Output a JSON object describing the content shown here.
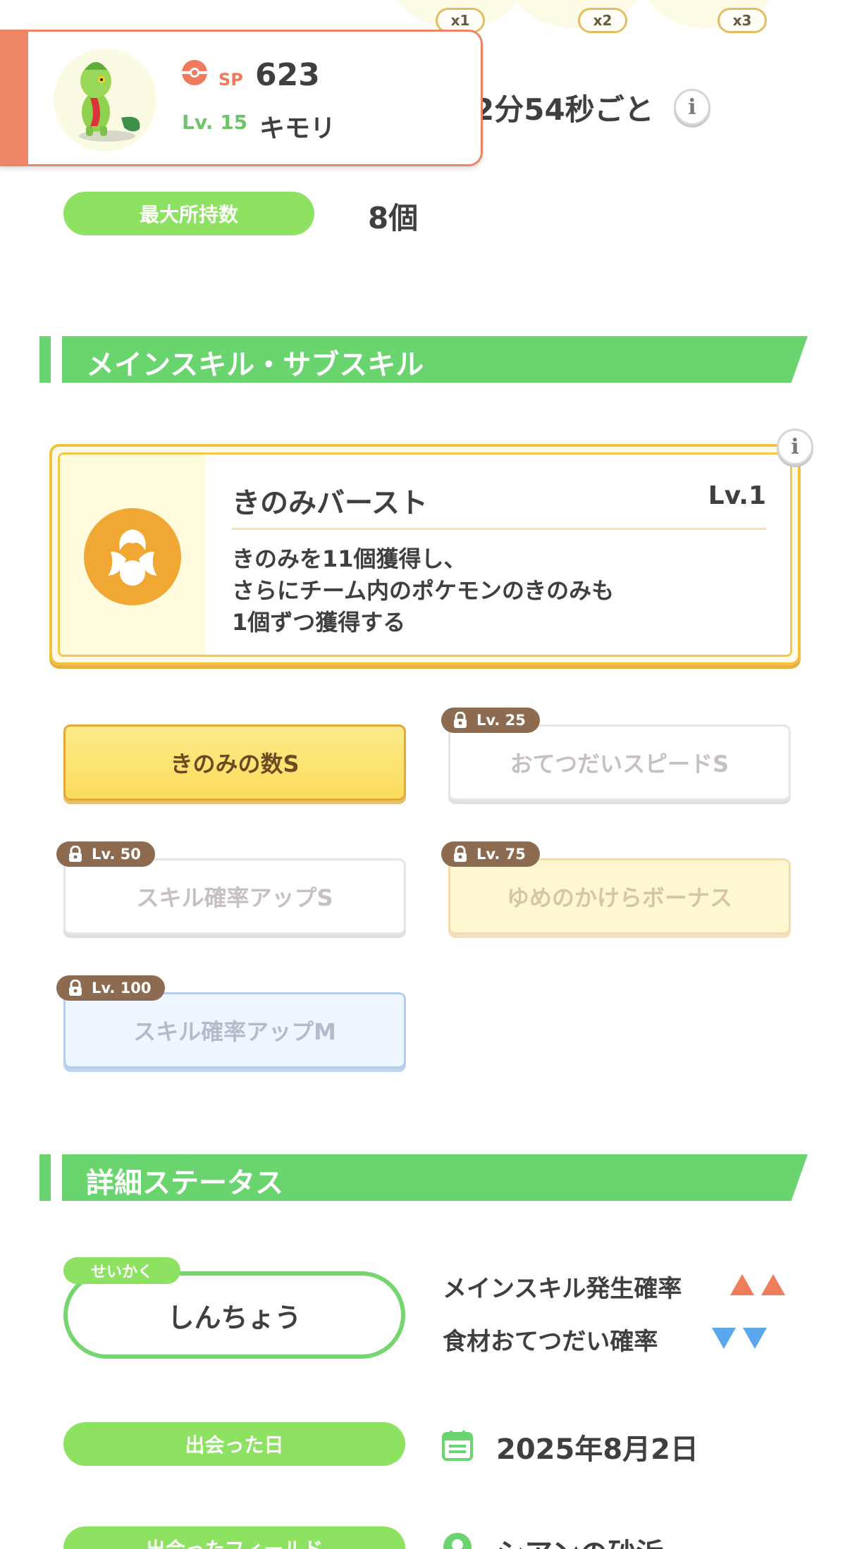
{
  "ingredient_multipliers": [
    "x1",
    "x2",
    "x3"
  ],
  "frequency": {
    "text": "2分54秒ごと"
  },
  "pokemon": {
    "sp_label": "SP",
    "sp_value": "623",
    "level_label": "Lv. 15",
    "name": "キモリ"
  },
  "max_inventory": {
    "label": "最大所持数",
    "value": "8個"
  },
  "skills_section": {
    "title": "メインスキル・サブスキル"
  },
  "main_skill": {
    "name": "きのみバースト",
    "level": "Lv.1",
    "description_lines": [
      "きのみを11個獲得し、",
      "さらにチーム内のポケモンのきのみも",
      "1個ずつ獲得する"
    ]
  },
  "sub_skills": [
    {
      "name": "きのみの数S",
      "lock": ""
    },
    {
      "name": "おてつだいスピードS",
      "lock": "Lv. 25"
    },
    {
      "name": "スキル確率アップS",
      "lock": "Lv. 50"
    },
    {
      "name": "ゆめのかけらボーナス",
      "lock": "Lv. 75"
    },
    {
      "name": "スキル確率アップM",
      "lock": "Lv. 100"
    }
  ],
  "detail_section": {
    "title": "詳細ステータス"
  },
  "nature": {
    "tag": "せいかく",
    "value": "しんちょう",
    "up_effect": "メインスキル発生確率",
    "down_effect": "食材おてつだい確率"
  },
  "met_date": {
    "label": "出会った日",
    "value": "2025年8月2日"
  },
  "met_field": {
    "label": "出会ったフィールド",
    "value": "シアンの砂浜"
  },
  "colors": {
    "accent_green": "#6ad46f",
    "pill_green": "#8de262",
    "card_orange": "#ee8566",
    "skill_gold": "#f0c23b",
    "up_red": "#ef7d5a",
    "down_blue": "#5aa7ee"
  }
}
